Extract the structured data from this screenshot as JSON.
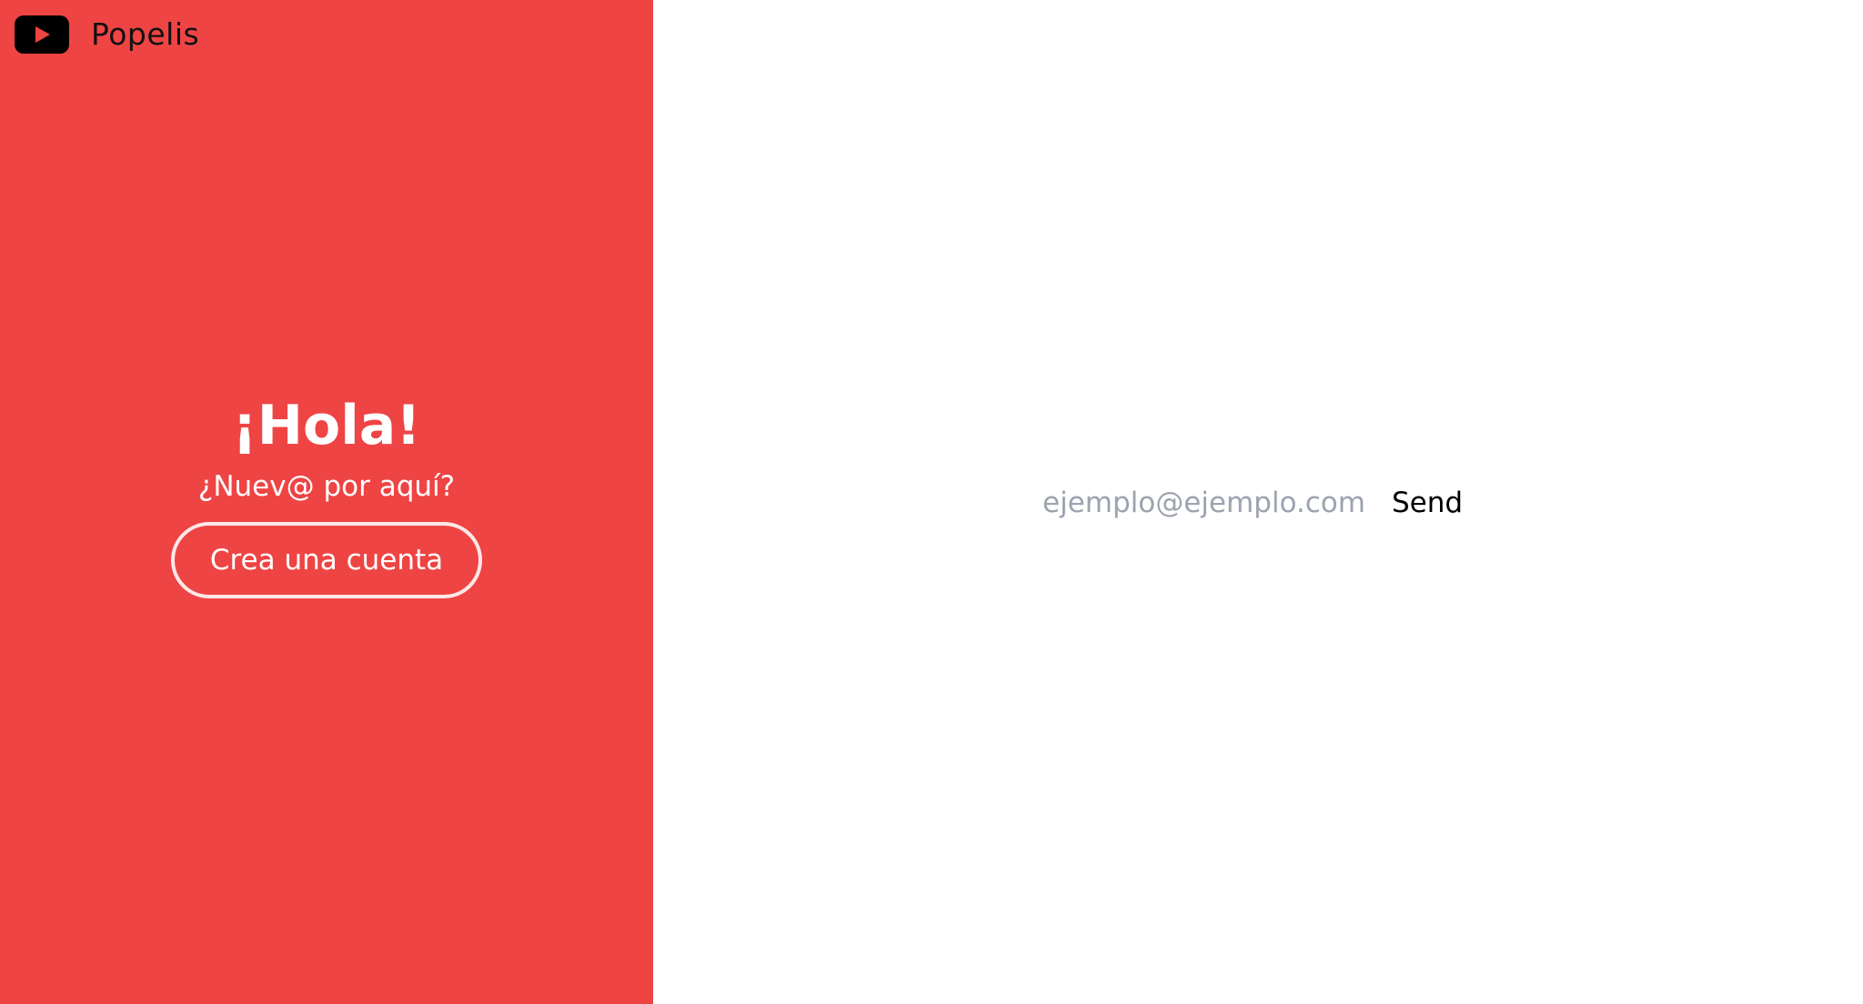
{
  "brand": {
    "name": "Popelis",
    "icon": "play-icon"
  },
  "hero": {
    "title": "¡Hola!",
    "subtitle": "¿Nuev@ por aquí?",
    "cta_label": "Crea una cuenta"
  },
  "signup": {
    "email_placeholder": "ejemplo@ejemplo.com",
    "email_value": "",
    "send_label": "Send"
  },
  "colors": {
    "panel_background": "#ef4444",
    "page_background": "#ffffff",
    "placeholder": "#9ca3af",
    "logo": "#000000"
  }
}
